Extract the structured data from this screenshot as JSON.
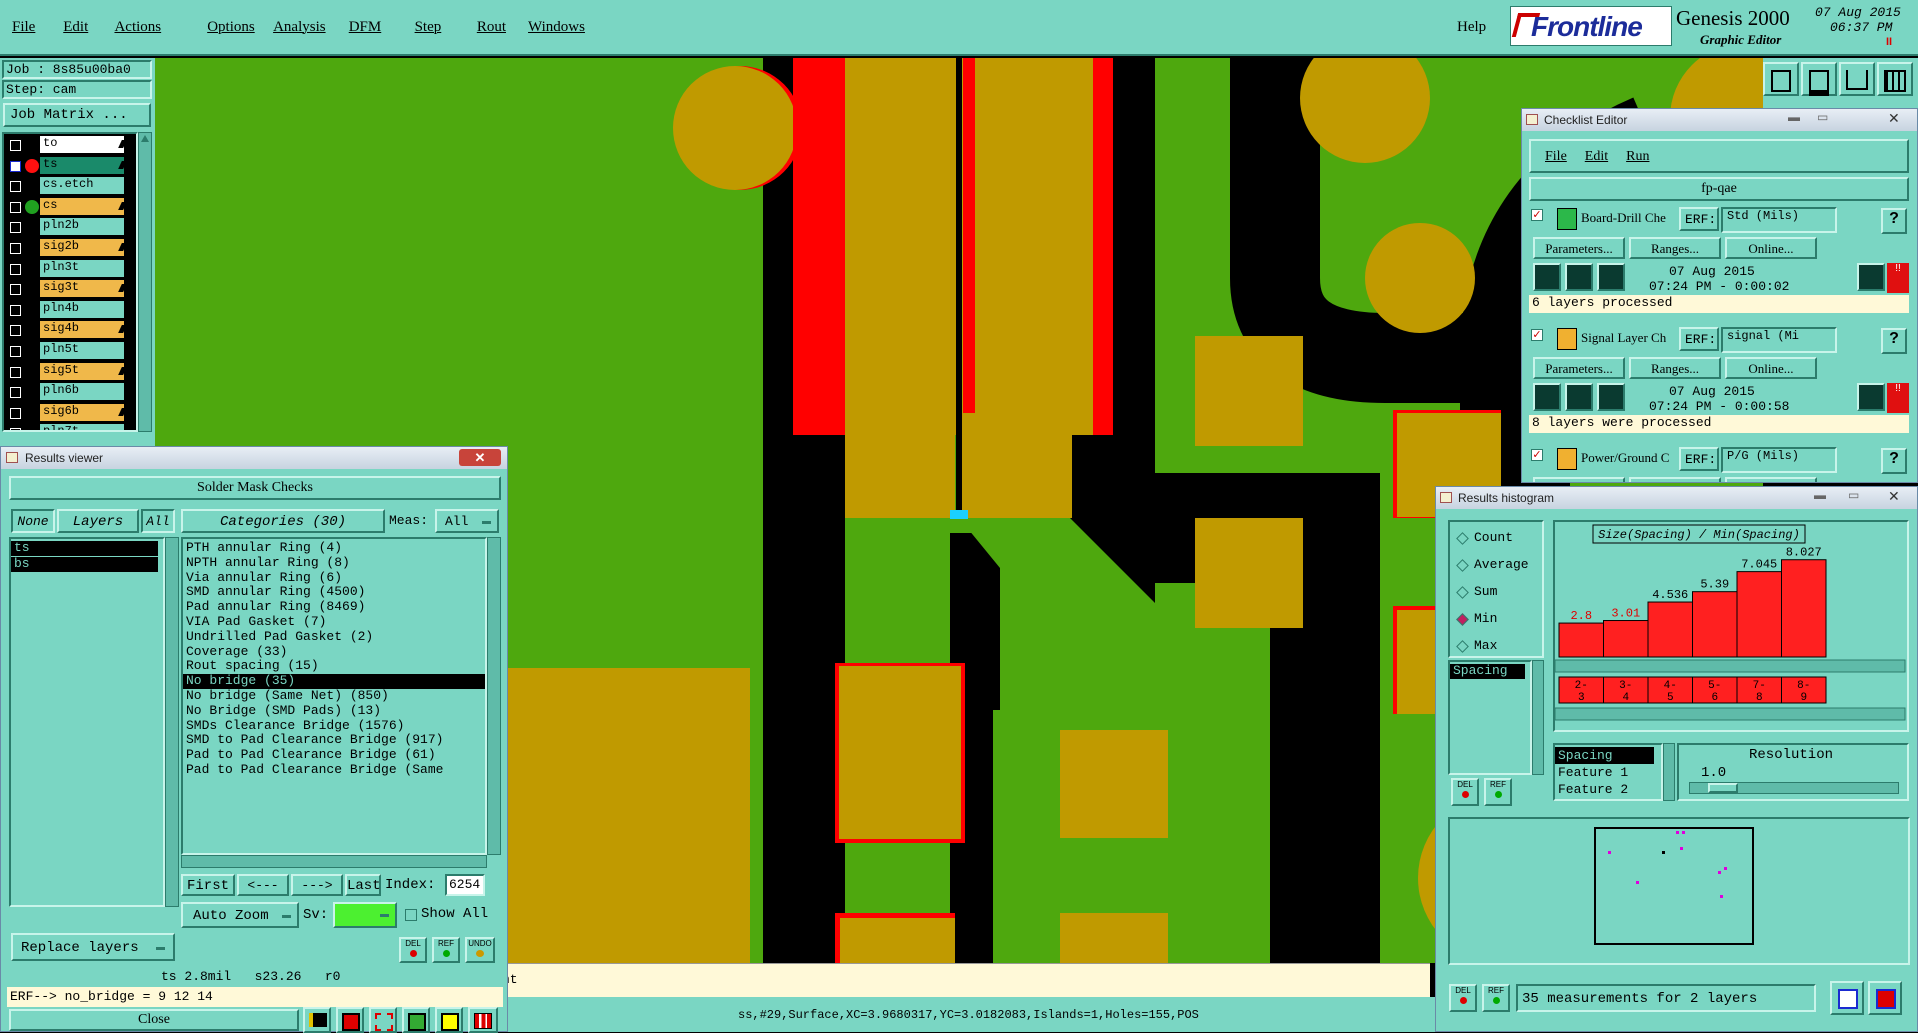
{
  "menubar": {
    "items": [
      "File",
      "Edit",
      "Actions",
      "Options",
      "Analysis",
      "DFM",
      "Step",
      "Rout",
      "Windows"
    ],
    "help": "Help",
    "brand": "Frontline",
    "product": "Genesis 2000",
    "subtitle": "Graphic Editor",
    "date": "07 Aug 2015",
    "time": "06:37 PM",
    "pause_glyph": "II"
  },
  "left_panel": {
    "job": "Job : 8s85u00ba0",
    "step": "Step: cam",
    "job_matrix": "Job Matrix ...",
    "layers": [
      {
        "name": "to",
        "color": "#ffffff",
        "marker": ""
      },
      {
        "name": "ts",
        "color": "#1a8a6a",
        "marker": "red-dot"
      },
      {
        "name": "cs.etch",
        "color": "#7ad6c3",
        "marker": ""
      },
      {
        "name": "cs",
        "color": "#f0b84a",
        "marker": "green-dot"
      },
      {
        "name": "pln2b",
        "color": "#7ad6c3",
        "marker": ""
      },
      {
        "name": "sig2b",
        "color": "#f0b84a",
        "marker": ""
      },
      {
        "name": "pln3t",
        "color": "#7ad6c3",
        "marker": ""
      },
      {
        "name": "sig3t",
        "color": "#f0b84a",
        "marker": ""
      },
      {
        "name": "pln4b",
        "color": "#7ad6c3",
        "marker": ""
      },
      {
        "name": "sig4b",
        "color": "#f0b84a",
        "marker": ""
      },
      {
        "name": "pln5t",
        "color": "#7ad6c3",
        "marker": ""
      },
      {
        "name": "sig5t",
        "color": "#f0b84a",
        "marker": ""
      },
      {
        "name": "pln6b",
        "color": "#7ad6c3",
        "marker": ""
      },
      {
        "name": "sig6b",
        "color": "#f0b84a",
        "marker": ""
      },
      {
        "name": "pln7t",
        "color": "#7ad6c3",
        "marker": ""
      }
    ]
  },
  "results_viewer": {
    "title": "Results viewer",
    "header": "Solder Mask Checks",
    "none_btn": "None",
    "layers_btn": "Layers",
    "all_btn": "All",
    "categories_btn": "Categories (30)",
    "meas_label": "Meas:",
    "meas_value": "All",
    "layers": [
      "ts",
      "bs"
    ],
    "categories": [
      "PTH annular Ring (4)",
      "NPTH annular Ring (8)",
      "Via annular Ring (6)",
      "SMD annular Ring (4500)",
      "Pad annular Ring (8469)",
      "VIA Pad Gasket (7)",
      "Undrilled Pad Gasket (2)",
      "Coverage (33)",
      "Rout spacing (15)",
      "No bridge (35)",
      "No bridge (Same Net) (850)",
      "No Bridge (SMD Pads) (13)",
      "SMDs Clearance Bridge (1576)",
      "SMD to Pad Clearance Bridge (917)",
      "Pad to Pad Clearance Bridge (61)",
      "Pad to Pad Clearance Bridge (Same"
    ],
    "selected_index": 9,
    "first_btn": "First",
    "prev_btn": "<---",
    "next_btn": "--->",
    "last_btn": "Last",
    "index_label": "Index:",
    "index_value": "6254",
    "auto_zoom": "Auto Zoom",
    "sv_label": "Sv:",
    "show_all": "Show All",
    "replace_layers": "Replace layers",
    "status_line": "ts 2.8mil   s23.26   r0",
    "erf_line": "ERF--> no_bridge = 9 12 14",
    "close_btn": "Close",
    "del_label": "DEL",
    "ref_label": "REF",
    "undo_label": "UNDO"
  },
  "checklist_editor": {
    "title": "Checklist Editor",
    "menu": [
      "File",
      "Edit",
      "Run"
    ],
    "checklist_name": "fp-qae",
    "erf_label": "ERF:",
    "parameters_btn": "Parameters...",
    "ranges_btn": "Ranges...",
    "online_btn": "Online...",
    "help_btn": "?",
    "checks": [
      {
        "name": "Board-Drill Che",
        "erf": "Std (Mils)",
        "date": "07 Aug 2015",
        "time": "07:24 PM - 0:00:02",
        "status": "6 layers processed"
      },
      {
        "name": "Signal Layer Ch",
        "erf": "signal (Mi",
        "date": "07 Aug 2015",
        "time": "07:24 PM - 0:00:58",
        "status": "8 layers were processed"
      },
      {
        "name": "Power/Ground C",
        "erf": "P/G (Mils)",
        "date": "",
        "time": "",
        "status": ""
      }
    ]
  },
  "results_histogram": {
    "title": "Results histogram",
    "modes": [
      "Count",
      "Average",
      "Sum",
      "Min",
      "Max"
    ],
    "selected_mode": "Min",
    "list": [
      "Spacing"
    ],
    "chart_title": "Size(Spacing) / Min(Spacing)",
    "feature_labels": [
      "Spacing",
      "Feature 1",
      "Feature 2"
    ],
    "resolution_label": "Resolution",
    "resolution_value": "1.0",
    "footer": "35 measurements for 2 layers",
    "del_label": "DEL",
    "ref_label": "REF"
  },
  "chart_data": {
    "type": "bar",
    "title": "Size(Spacing) / Min(Spacing)",
    "categories": [
      "2-3",
      "3-4",
      "4-5",
      "5-6",
      "7-8",
      "8-9"
    ],
    "values": [
      2.8,
      3.01,
      4.536,
      5.39,
      7.045,
      8.027
    ],
    "value_labels": [
      "2.8",
      "3.01",
      "4.536",
      "5.39",
      "7.045",
      "8.027"
    ],
    "ylim": [
      0,
      8.5
    ],
    "bar_color": "#ff2020"
  },
  "status_bar": {
    "text": "ss,#29,Surface,XC=3.9680317,YC=3.0182083,Islands=1,Holes=155,POS",
    "msg_fragment": "nt"
  },
  "colors": {
    "panel": "#7ad6c3",
    "canvas_green": "#4ea80e",
    "canvas_gold": "#c09a00",
    "canvas_red": "#ff0000",
    "canvas_bg": "#000000"
  }
}
